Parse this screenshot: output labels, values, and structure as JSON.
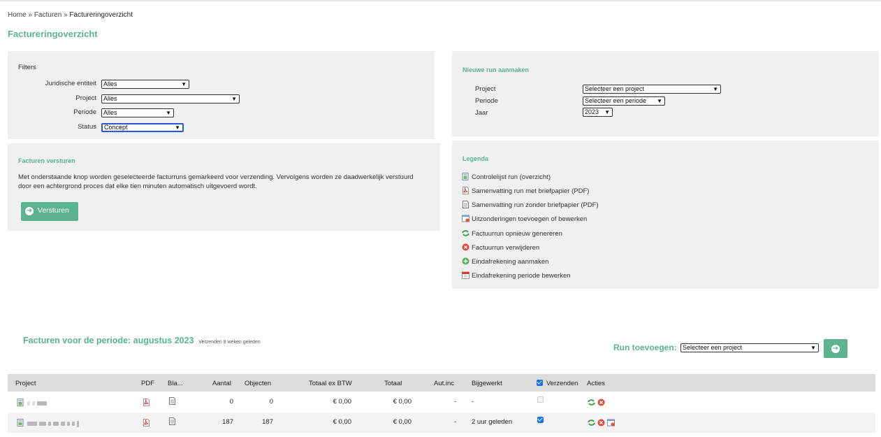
{
  "breadcrumb": {
    "home": "Home",
    "sep1": "»",
    "facturen": "Facturen",
    "sep2": "»",
    "current": "Factureringoverzicht"
  },
  "page_title": "Factureringoverzicht",
  "filters": {
    "title": "Filters",
    "entity_label": "Juridische entiteit",
    "entity_value": "Alles",
    "project_label": "Project",
    "project_value": "Alles",
    "period_label": "Periode",
    "period_value": "Alles",
    "status_label": "Status",
    "status_value": "Concept"
  },
  "send": {
    "title": "Facturen versturen",
    "text1": "Met onderstaande knop worden geselecteerde facturruns gemarkeerd voor verzending. Vervolgens worden ze daadwerkelijk verstuurd",
    "text2": "door een achtergrond proces dat elke tien minuten automatisch uitgevoerd wordt.",
    "button": "Versturen"
  },
  "new_run": {
    "title": "Nieuwe run aanmaken",
    "project_label": "Project",
    "project_value": "Selecteer een project",
    "period_label": "Periode",
    "period_value": "Selecteer een periode",
    "year_label": "Jaar",
    "year_value": "2023"
  },
  "legend": {
    "title": "Legenda",
    "items": [
      {
        "icon": "checklist-icon",
        "label": "Controlelijst run (overzicht)"
      },
      {
        "icon": "pdf-icon",
        "label": "Samenvatting run met briefpapier (PDF)"
      },
      {
        "icon": "document-icon",
        "label": "Samenvatting run zonder briefpapier (PDF)"
      },
      {
        "icon": "exceptions-icon",
        "label": "Uitzonderingen toevoegen of bewerken"
      },
      {
        "icon": "regenerate-icon",
        "label": "Factuurrun opnieuw genereren"
      },
      {
        "icon": "delete-icon",
        "label": "Factuurrun verwijderen"
      },
      {
        "icon": "add-icon",
        "label": "Eindafrekening aanmaken"
      },
      {
        "icon": "calendar-icon",
        "label": "Eindafrekening periode bewerken"
      }
    ]
  },
  "period": {
    "title": "Facturen voor de periode: augustus 2023",
    "subtitle": "Verzenden 8 weken geleden",
    "add_run_label": "Run toevoegen:",
    "add_run_value": "Selecteer een project"
  },
  "table": {
    "headers": {
      "project": "Project",
      "pdf": "PDF",
      "bla": "Bla...",
      "aantal": "Aantal",
      "objecten": "Objecten",
      "totaal_ex": "Totaal ex BTW",
      "totaal": "Totaal",
      "autinc": "Aut.inc",
      "bijgewerkt": "Bijgewerkt",
      "verzenden": "Verzenden",
      "acties": "Acties"
    },
    "verzenden_all_checked": true,
    "rows": [
      {
        "aantal": "0",
        "objecten": "0",
        "totaal_ex": "€ 0,00",
        "totaal": "€ 0,00",
        "autinc": "-",
        "bijgewerkt": "-",
        "verzenden": false
      },
      {
        "aantal": "187",
        "objecten": "187",
        "totaal_ex": "€ 0,00",
        "totaal": "€ 0,00",
        "autinc": "-",
        "bijgewerkt": "2 uur geleden",
        "verzenden": true
      }
    ]
  },
  "colors": {
    "accent": "#5bb48f",
    "panel": "#f0f0f0",
    "table_header": "#dcdcdc"
  }
}
